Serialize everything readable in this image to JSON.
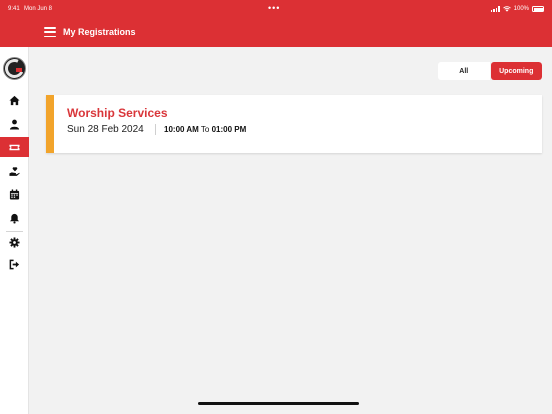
{
  "status_bar": {
    "time": "9:41",
    "date": "Mon Jun 8",
    "battery": "100%"
  },
  "header": {
    "title": "My Registrations"
  },
  "sidebar": {
    "items": [
      {
        "name": "home",
        "icon": "home-icon"
      },
      {
        "name": "profile",
        "icon": "user-icon"
      },
      {
        "name": "registrations",
        "icon": "ticket-icon",
        "active": true
      },
      {
        "name": "giving",
        "icon": "hand-heart-icon"
      },
      {
        "name": "calendar",
        "icon": "calendar-icon"
      },
      {
        "name": "notifications",
        "icon": "bell-icon"
      },
      {
        "name": "settings",
        "icon": "gear-icon"
      },
      {
        "name": "logout",
        "icon": "logout-icon"
      }
    ]
  },
  "filter": {
    "all_label": "All",
    "upcoming_label": "Upcoming",
    "selected": "Upcoming"
  },
  "registrations": [
    {
      "name": "Worship Services",
      "date": "Sun 28 Feb 2024",
      "start": "10:00 AM",
      "to": "To",
      "end": "01:00 PM"
    }
  ],
  "colors": {
    "accent": "#dc3034",
    "card_stripe": "#f2a42b",
    "background": "#f2f2f2"
  }
}
